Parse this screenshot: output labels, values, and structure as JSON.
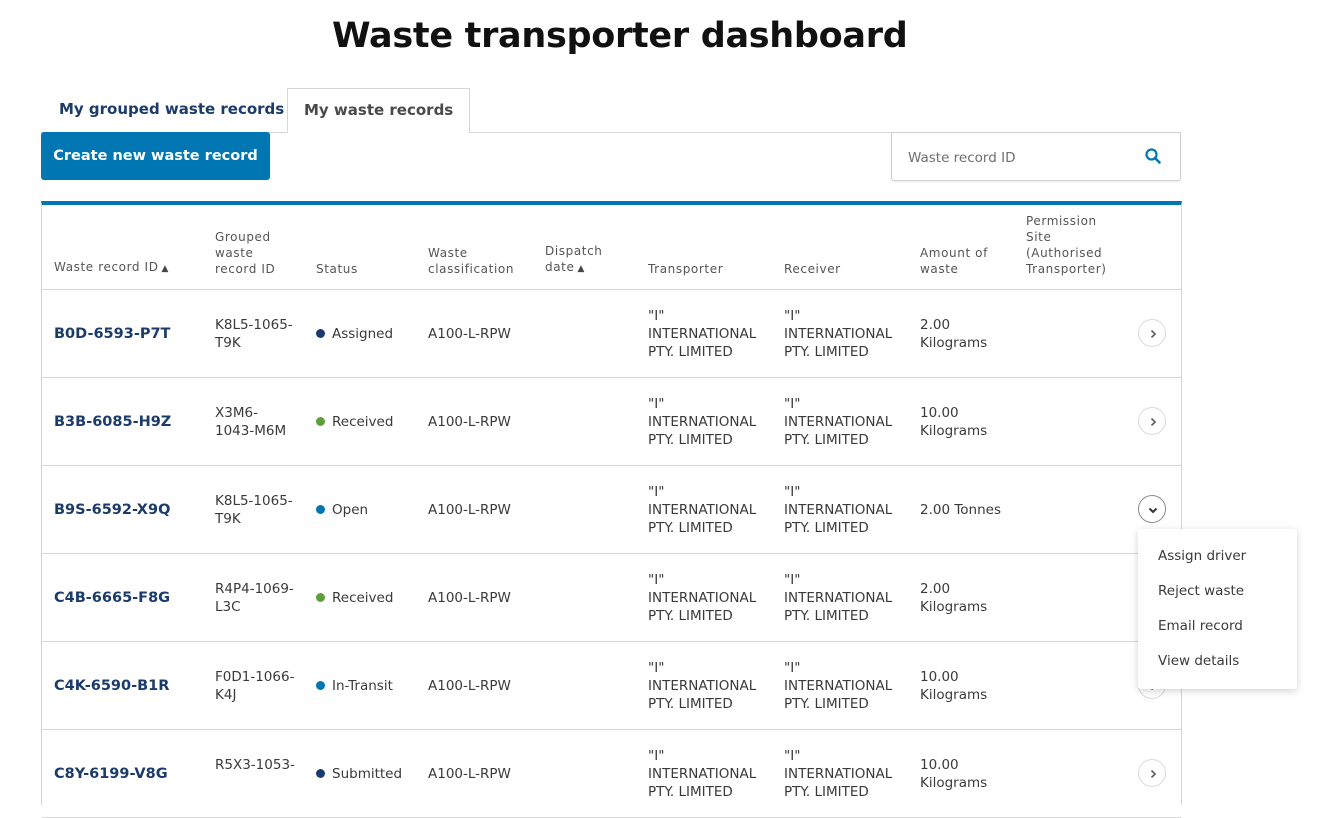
{
  "page": {
    "title": "Waste transporter dashboard"
  },
  "tabs": [
    {
      "label": "My grouped waste records",
      "active": false
    },
    {
      "label": "My waste records",
      "active": true
    }
  ],
  "toolbar": {
    "create_label": "Create new waste record"
  },
  "search": {
    "placeholder": "Waste record ID",
    "value": "",
    "icon": "search-icon"
  },
  "colors": {
    "accent": "#0077b3",
    "link": "#1b3b6b",
    "status_assigned": "#1b3b6b",
    "status_received": "#5fa03a",
    "status_open": "#0077b3",
    "status_in_transit": "#0077b3"
  },
  "table": {
    "columns": [
      {
        "label": "Waste record ID",
        "sorted": "asc"
      },
      {
        "label": "Grouped waste record ID"
      },
      {
        "label": "Status"
      },
      {
        "label": "Waste classification"
      },
      {
        "label": "Dispatch date",
        "sorted": "asc"
      },
      {
        "label": "Transporter"
      },
      {
        "label": "Receiver"
      },
      {
        "label": "Amount of waste"
      },
      {
        "label": "Permission Site (Authorised Transporter)"
      }
    ],
    "rows": [
      {
        "id": "B0D-6593-P7T",
        "grouped_id": "K8L5-1065-T9K",
        "status": "Assigned",
        "status_color": "#1b3b6b",
        "classification": "A100-L-RPW",
        "dispatch_date": "",
        "transporter": "\"I\" INTERNATIONAL PTY. LIMITED",
        "receiver": "\"I\" INTERNATIONAL PTY. LIMITED",
        "amount": "2.00 Kilograms",
        "permission_site": "",
        "action": "chevron-right"
      },
      {
        "id": "B3B-6085-H9Z",
        "grouped_id": "X3M6-1043-M6M",
        "status": "Received",
        "status_color": "#5fa03a",
        "classification": "A100-L-RPW",
        "dispatch_date": "",
        "transporter": "\"I\" INTERNATIONAL PTY. LIMITED",
        "receiver": "\"I\" INTERNATIONAL PTY. LIMITED",
        "amount": "10.00 Kilograms",
        "permission_site": "",
        "action": "chevron-right"
      },
      {
        "id": "B9S-6592-X9Q",
        "grouped_id": "K8L5-1065-T9K",
        "status": "Open",
        "status_color": "#0077b3",
        "classification": "A100-L-RPW",
        "dispatch_date": "",
        "transporter": "\"I\" INTERNATIONAL PTY. LIMITED",
        "receiver": "\"I\" INTERNATIONAL PTY. LIMITED",
        "amount": "2.00 Tonnes",
        "permission_site": "",
        "action": "chevron-down"
      },
      {
        "id": "C4B-6665-F8G",
        "grouped_id": "R4P4-1069-L3C",
        "status": "Received",
        "status_color": "#5fa03a",
        "classification": "A100-L-RPW",
        "dispatch_date": "",
        "transporter": "\"I\" INTERNATIONAL PTY. LIMITED",
        "receiver": "\"I\" INTERNATIONAL PTY. LIMITED",
        "amount": "2.00 Kilograms",
        "permission_site": "",
        "action": "chevron-right"
      },
      {
        "id": "C4K-6590-B1R",
        "grouped_id": "F0D1-1066-K4J",
        "status": "In-Transit",
        "status_color": "#0077b3",
        "classification": "A100-L-RPW",
        "dispatch_date": "",
        "transporter": "\"I\" INTERNATIONAL PTY. LIMITED",
        "receiver": "\"I\" INTERNATIONAL PTY. LIMITED",
        "amount": "10.00 Kilograms",
        "permission_site": "",
        "action": "chevron-right"
      },
      {
        "id": "C8Y-6199-V8G",
        "grouped_id": "R5X3-1053-",
        "status": "Submitted",
        "status_color": "#1b3b6b",
        "classification": "A100-L-RPW",
        "dispatch_date": "",
        "transporter": "\"I\" INTERNATIONAL PTY. LIMITED",
        "receiver": "\"I\" INTERNATIONAL PTY. LIMITED",
        "amount": "10.00 Kilograms",
        "permission_site": "",
        "action": "chevron-right"
      }
    ]
  },
  "row_menu": {
    "items": [
      "Assign driver",
      "Reject waste",
      "Email record",
      "View details"
    ]
  }
}
